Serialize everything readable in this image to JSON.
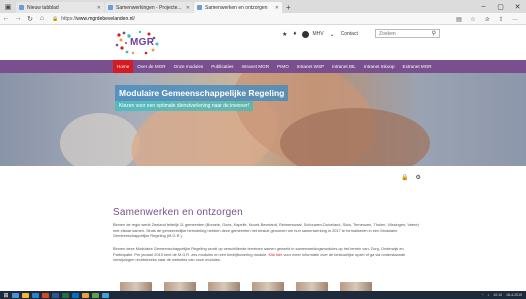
{
  "browser": {
    "tabs": [
      {
        "label": "Nieuw tabblad"
      },
      {
        "label": "Samenwerkingen - Projecte..."
      },
      {
        "label": "Samenwerken en ontzorgen"
      }
    ],
    "new_tab": "+",
    "url_prefix": "https://",
    "url_domain": "www.mgrdebevelanden.nl",
    "url_path": "/"
  },
  "header": {
    "logo_text": "MGR",
    "user_label": "MHV",
    "contact_label": "Contact",
    "search_placeholder": "Zoeken"
  },
  "nav": {
    "items": [
      {
        "label": "Home",
        "active": true
      },
      {
        "label": "Over de MGR"
      },
      {
        "label": "Onze modules"
      },
      {
        "label": "Publicaties"
      },
      {
        "label": "Intranet MGR"
      },
      {
        "label": "PIMO"
      },
      {
        "label": "Intranet WSP"
      },
      {
        "label": "Intranet IBL"
      },
      {
        "label": "Intranet Inkoop"
      },
      {
        "label": "Extranet MGR"
      }
    ]
  },
  "hero": {
    "title": "Modulaire Gemeenschappelijke Regeling",
    "subtitle": "Kiezen voor een optimale dienstverlening naar de inwoner!"
  },
  "content": {
    "heading": "Samenwerken en ontzorgen",
    "paragraph1": "Binnen de regio werkt Zeeland feitelijk 11 gemeenten (Borsele, Goes, Kapelle, Noord-Beveland, Reimerswaal, Schouwen-Duiveland, Sluis, Terneuzen, Tholen, Vlissingen, Veere) met elkaar samen. Sinds de gemeentelijke herindeling hebben deze gemeenten het besluit genomen om hun samenwerking in 2017 te formaliseren in een Modulaire Gemeenschappelijke Regeling (M.G.R.).",
    "paragraph2_before": "Binnen deze Modulaire Gemeenschappelijke Regeling wordt op verschillende terreinen samen gewerkt in samenwerkingsmodules op het terrein van: Zorg, Onderwijs en Participatie. Per januari 2019 kent de M.G.R. zes modules en een bedrijfsvoering module.",
    "paragraph2_link": "Klik hier",
    "paragraph2_after": "voor meer informatie over de bestuurlijke opzet of ga via onderstaande verwijzingen rechtstreeks naar de websites van onze modules."
  },
  "taskbar": {
    "time": "10:10",
    "date": "18-4-2019"
  },
  "colors": {
    "brand_purple": "#7a4f8e",
    "nav_active_red": "#d71920",
    "hero_title_bg": "#468cbe",
    "hero_subtitle_bg": "#3cbebe"
  }
}
